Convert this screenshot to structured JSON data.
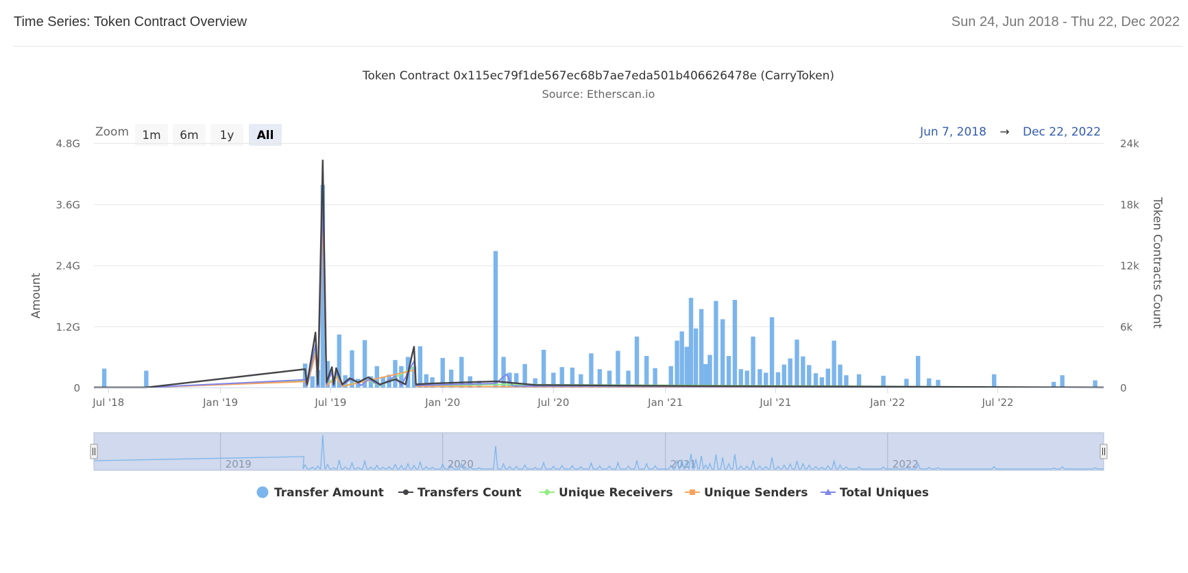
{
  "header": {
    "title": "Time Series: Token Contract Overview",
    "date_range": "Sun 24, Jun 2018 - Thu 22, Dec 2022"
  },
  "range_selector": {
    "zoom_label": "Zoom",
    "buttons": [
      "1m",
      "6m",
      "1y",
      "All"
    ],
    "selected": "All",
    "from": "Jun 7, 2018",
    "arrow": "→",
    "to": "Dec 22, 2022"
  },
  "colors": {
    "transfer_amount": "#7cb5ec",
    "transfers_count": "#434348",
    "unique_receivers": "#90ed7d",
    "unique_senders": "#f7a35c",
    "total_uniques": "#8085e9",
    "navigator_fill": "#c8d2ea"
  },
  "chart_data": {
    "type": "bar",
    "title": "Token Contract 0x115ec79f1de567ec68b7ae7eda501b406626478e (CarryToken)",
    "subtitle": "Source: Etherscan.io",
    "ylabel": "Amount",
    "ylabel_right": "Token Contracts Count",
    "xlim": [
      "2018-06-07",
      "2022-12-22"
    ],
    "ylim": [
      0,
      4800000000
    ],
    "ylim_right": [
      0,
      24000
    ],
    "y_ticks": [
      {
        "value": 0,
        "label": "0"
      },
      {
        "value": 1200000000,
        "label": "1.2G"
      },
      {
        "value": 2400000000,
        "label": "2.4G"
      },
      {
        "value": 3600000000,
        "label": "3.6G"
      },
      {
        "value": 4800000000,
        "label": "4.8G"
      }
    ],
    "y_right_ticks": [
      {
        "value": 0,
        "label": "0"
      },
      {
        "value": 6000,
        "label": "6k"
      },
      {
        "value": 12000,
        "label": "12k"
      },
      {
        "value": 18000,
        "label": "18k"
      },
      {
        "value": 24000,
        "label": "24k"
      }
    ],
    "x_ticks": [
      {
        "date": "2018-07-01",
        "label": "Jul '18"
      },
      {
        "date": "2019-01-01",
        "label": "Jan '19"
      },
      {
        "date": "2019-07-01",
        "label": "Jul '19"
      },
      {
        "date": "2020-01-01",
        "label": "Jan '20"
      },
      {
        "date": "2020-07-01",
        "label": "Jul '20"
      },
      {
        "date": "2021-01-01",
        "label": "Jan '21"
      },
      {
        "date": "2021-07-01",
        "label": "Jul '21"
      },
      {
        "date": "2022-01-01",
        "label": "Jan '22"
      },
      {
        "date": "2022-07-01",
        "label": "Jul '22"
      }
    ],
    "navigator_labels": [
      {
        "date": "2019-01-01",
        "label": "2019"
      },
      {
        "date": "2020-01-01",
        "label": "2020"
      },
      {
        "date": "2021-01-01",
        "label": "2021"
      },
      {
        "date": "2022-01-01",
        "label": "2022"
      }
    ],
    "legend": [
      "Transfer Amount",
      "Transfers Count",
      "Unique Receivers",
      "Unique Senders",
      "Total Uniques"
    ],
    "legend_position": "bottom-center",
    "grid": true,
    "series": [
      {
        "name": "Transfer Amount",
        "type": "column",
        "axis": "left",
        "points": [
          [
            "2018-06-24",
            370000000
          ],
          [
            "2018-09-01",
            330000000
          ],
          [
            "2019-05-20",
            470000000
          ],
          [
            "2019-06-01",
            220000000
          ],
          [
            "2019-06-10",
            340000000
          ],
          [
            "2019-06-18",
            3980000000
          ],
          [
            "2019-06-26",
            520000000
          ],
          [
            "2019-07-06",
            150000000
          ],
          [
            "2019-07-15",
            1040000000
          ],
          [
            "2019-07-25",
            240000000
          ],
          [
            "2019-08-05",
            730000000
          ],
          [
            "2019-08-15",
            170000000
          ],
          [
            "2019-08-26",
            930000000
          ],
          [
            "2019-09-05",
            220000000
          ],
          [
            "2019-09-15",
            420000000
          ],
          [
            "2019-09-25",
            210000000
          ],
          [
            "2019-10-05",
            250000000
          ],
          [
            "2019-10-15",
            540000000
          ],
          [
            "2019-10-25",
            420000000
          ],
          [
            "2019-11-05",
            600000000
          ],
          [
            "2019-11-15",
            410000000
          ],
          [
            "2019-11-25",
            810000000
          ],
          [
            "2019-12-05",
            260000000
          ],
          [
            "2019-12-15",
            200000000
          ],
          [
            "2020-01-01",
            580000000
          ],
          [
            "2020-01-15",
            350000000
          ],
          [
            "2020-02-01",
            600000000
          ],
          [
            "2020-02-15",
            220000000
          ],
          [
            "2020-03-01",
            130000000
          ],
          [
            "2020-03-28",
            2680000000
          ],
          [
            "2020-04-10",
            600000000
          ],
          [
            "2020-04-20",
            290000000
          ],
          [
            "2020-05-01",
            280000000
          ],
          [
            "2020-05-15",
            460000000
          ],
          [
            "2020-06-01",
            180000000
          ],
          [
            "2020-06-15",
            740000000
          ],
          [
            "2020-07-01",
            290000000
          ],
          [
            "2020-07-15",
            400000000
          ],
          [
            "2020-08-01",
            390000000
          ],
          [
            "2020-08-15",
            260000000
          ],
          [
            "2020-09-01",
            670000000
          ],
          [
            "2020-09-15",
            360000000
          ],
          [
            "2020-10-01",
            330000000
          ],
          [
            "2020-10-15",
            720000000
          ],
          [
            "2020-11-01",
            330000000
          ],
          [
            "2020-11-15",
            1000000000
          ],
          [
            "2020-12-01",
            620000000
          ],
          [
            "2020-12-15",
            380000000
          ],
          [
            "2021-01-10",
            420000000
          ],
          [
            "2021-01-20",
            920000000
          ],
          [
            "2021-01-28",
            1100000000
          ],
          [
            "2021-02-05",
            800000000
          ],
          [
            "2021-02-12",
            1760000000
          ],
          [
            "2021-02-20",
            1160000000
          ],
          [
            "2021-03-01",
            1540000000
          ],
          [
            "2021-03-08",
            460000000
          ],
          [
            "2021-03-15",
            640000000
          ],
          [
            "2021-03-25",
            1700000000
          ],
          [
            "2021-04-05",
            1340000000
          ],
          [
            "2021-04-15",
            620000000
          ],
          [
            "2021-04-25",
            1720000000
          ],
          [
            "2021-05-05",
            360000000
          ],
          [
            "2021-05-15",
            330000000
          ],
          [
            "2021-05-25",
            1000000000
          ],
          [
            "2021-06-05",
            360000000
          ],
          [
            "2021-06-15",
            290000000
          ],
          [
            "2021-06-25",
            1380000000
          ],
          [
            "2021-07-05",
            300000000
          ],
          [
            "2021-07-15",
            450000000
          ],
          [
            "2021-07-25",
            570000000
          ],
          [
            "2021-08-05",
            940000000
          ],
          [
            "2021-08-15",
            610000000
          ],
          [
            "2021-08-25",
            440000000
          ],
          [
            "2021-09-05",
            280000000
          ],
          [
            "2021-09-15",
            200000000
          ],
          [
            "2021-09-25",
            370000000
          ],
          [
            "2021-10-05",
            920000000
          ],
          [
            "2021-10-15",
            450000000
          ],
          [
            "2021-10-25",
            240000000
          ],
          [
            "2021-11-15",
            260000000
          ],
          [
            "2021-12-25",
            230000000
          ],
          [
            "2022-02-01",
            170000000
          ],
          [
            "2022-02-20",
            620000000
          ],
          [
            "2022-03-10",
            180000000
          ],
          [
            "2022-03-25",
            150000000
          ],
          [
            "2022-06-25",
            260000000
          ],
          [
            "2022-10-01",
            110000000
          ],
          [
            "2022-10-15",
            240000000
          ],
          [
            "2022-12-08",
            140000000
          ]
        ]
      },
      {
        "name": "Transfers Count",
        "type": "line",
        "axis": "right",
        "points": [
          [
            "2018-06-07",
            0
          ],
          [
            "2018-09-01",
            0
          ],
          [
            "2019-05-20",
            1800
          ],
          [
            "2019-05-23",
            300
          ],
          [
            "2019-06-06",
            5400
          ],
          [
            "2019-06-10",
            300
          ],
          [
            "2019-06-18",
            22300
          ],
          [
            "2019-06-24",
            500
          ],
          [
            "2019-07-03",
            2000
          ],
          [
            "2019-07-06",
            300
          ],
          [
            "2019-07-10",
            1900
          ],
          [
            "2019-07-20",
            300
          ],
          [
            "2019-08-01",
            900
          ],
          [
            "2019-08-15",
            500
          ],
          [
            "2019-09-01",
            1000
          ],
          [
            "2019-09-20",
            300
          ],
          [
            "2019-10-15",
            800
          ],
          [
            "2019-11-01",
            300
          ],
          [
            "2019-11-12",
            3300
          ],
          [
            "2019-11-15",
            4000
          ],
          [
            "2019-11-18",
            300
          ],
          [
            "2019-12-15",
            400
          ],
          [
            "2020-03-28",
            600
          ],
          [
            "2020-06-01",
            250
          ],
          [
            "2021-02-12",
            150
          ],
          [
            "2022-12-22",
            0
          ]
        ]
      },
      {
        "name": "Unique Receivers",
        "type": "line",
        "axis": "right",
        "points": [
          [
            "2018-06-07",
            0
          ],
          [
            "2018-09-01",
            0
          ],
          [
            "2019-05-20",
            650
          ],
          [
            "2019-05-23",
            100
          ],
          [
            "2019-06-06",
            3600
          ],
          [
            "2019-06-10",
            100
          ],
          [
            "2019-06-18",
            17200
          ],
          [
            "2019-06-24",
            200
          ],
          [
            "2019-07-10",
            1200
          ],
          [
            "2019-07-20",
            150
          ],
          [
            "2019-09-01",
            700
          ],
          [
            "2019-09-20",
            150
          ],
          [
            "2019-11-15",
            2000
          ],
          [
            "2019-11-18",
            150
          ],
          [
            "2020-03-28",
            300
          ],
          [
            "2022-12-22",
            0
          ]
        ]
      },
      {
        "name": "Unique Senders",
        "type": "line",
        "axis": "right",
        "points": [
          [
            "2018-06-07",
            0
          ],
          [
            "2018-09-01",
            0
          ],
          [
            "2019-05-20",
            580
          ],
          [
            "2019-05-23",
            80
          ],
          [
            "2019-06-06",
            3300
          ],
          [
            "2019-06-10",
            80
          ],
          [
            "2019-06-18",
            16600
          ],
          [
            "2019-06-24",
            150
          ],
          [
            "2019-07-10",
            1000
          ],
          [
            "2019-07-20",
            100
          ],
          [
            "2019-11-15",
            1700
          ],
          [
            "2019-11-18",
            100
          ],
          [
            "2022-12-22",
            0
          ]
        ]
      },
      {
        "name": "Total Uniques",
        "type": "line",
        "axis": "right",
        "points": [
          [
            "2018-06-07",
            0
          ],
          [
            "2018-09-01",
            0
          ],
          [
            "2019-05-20",
            750
          ],
          [
            "2019-05-23",
            120
          ],
          [
            "2019-06-06",
            4200
          ],
          [
            "2019-06-10",
            120
          ],
          [
            "2019-06-18",
            18600
          ],
          [
            "2019-06-24",
            300
          ],
          [
            "2019-07-03",
            1500
          ],
          [
            "2019-07-06",
            150
          ],
          [
            "2019-07-10",
            1500
          ],
          [
            "2019-07-20",
            200
          ],
          [
            "2019-08-05",
            900
          ],
          [
            "2019-08-20",
            200
          ],
          [
            "2019-09-01",
            800
          ],
          [
            "2019-09-20",
            200
          ],
          [
            "2019-10-15",
            1100
          ],
          [
            "2019-10-25",
            200
          ],
          [
            "2019-11-15",
            2600
          ],
          [
            "2019-11-18",
            200
          ],
          [
            "2020-03-28",
            400
          ],
          [
            "2020-04-15",
            1300
          ],
          [
            "2020-04-25",
            150
          ],
          [
            "2022-12-22",
            0
          ]
        ]
      }
    ]
  }
}
